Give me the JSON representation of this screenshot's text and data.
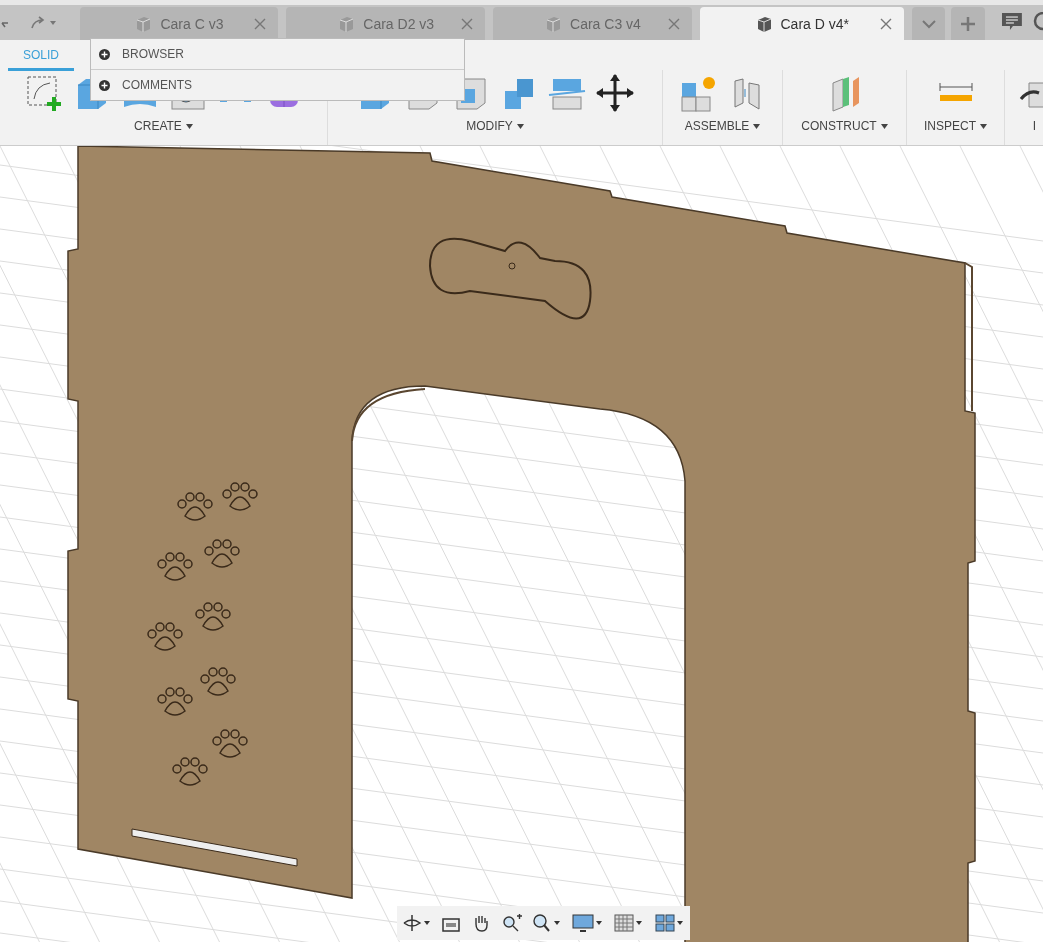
{
  "tabs": [
    {
      "label": "Cara C v3",
      "selected": false
    },
    {
      "label": "Cara D2 v3",
      "selected": false
    },
    {
      "label": "Cara C3 v4",
      "selected": false
    },
    {
      "label": "Cara D v4*",
      "selected": true
    }
  ],
  "workspace_tabs": [
    {
      "label": "SOLID",
      "selected": true
    }
  ],
  "panel_menu": [
    {
      "label": "BROWSER"
    },
    {
      "label": "COMMENTS"
    }
  ],
  "toolbar_groups": [
    {
      "label": "CREATE"
    },
    {
      "label": "MODIFY"
    },
    {
      "label": "ASSEMBLE"
    },
    {
      "label": "CONSTRUCT"
    },
    {
      "label": "INSPECT"
    },
    {
      "label": "I"
    }
  ]
}
